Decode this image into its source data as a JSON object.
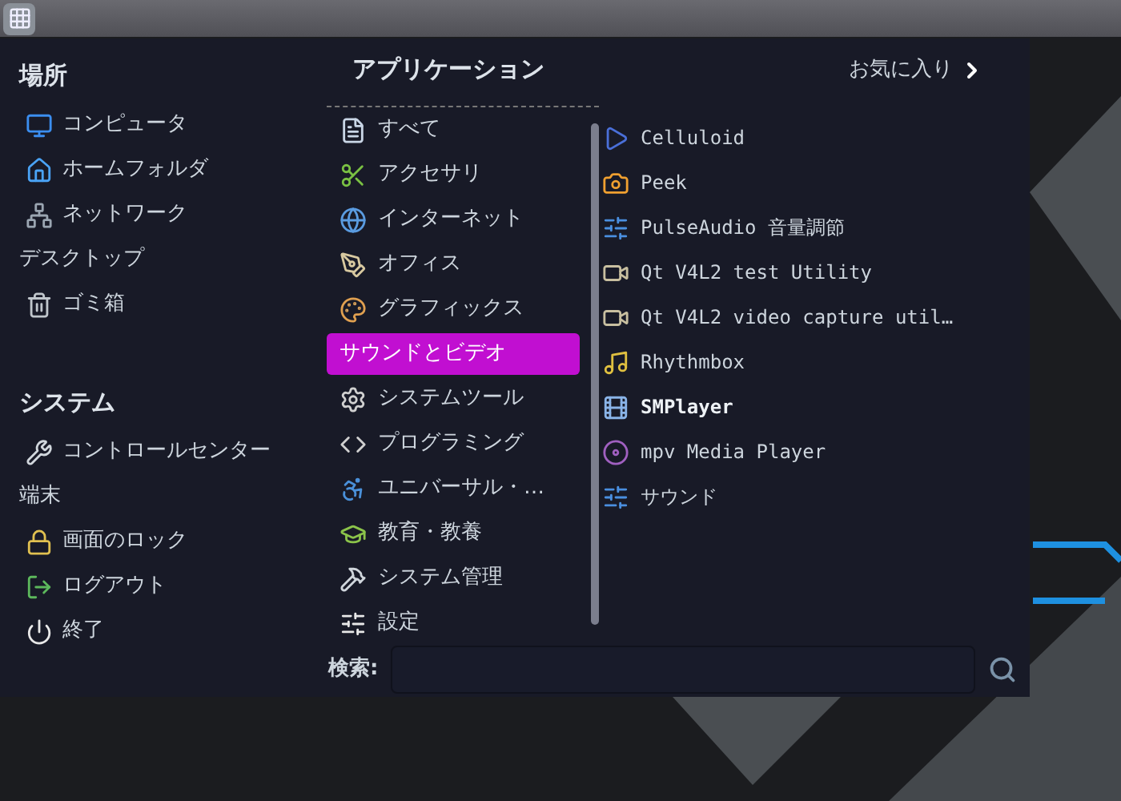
{
  "places": {
    "title": "場所",
    "items": [
      {
        "label": "コンピュータ",
        "kind": "with_icon"
      },
      {
        "label": "ホームフォルダ",
        "kind": "with_icon"
      },
      {
        "label": "ネットワーク",
        "kind": "with_icon"
      },
      {
        "label": "デスクトップ",
        "kind": "text_only"
      },
      {
        "label": "ゴミ箱",
        "kind": "with_icon"
      }
    ]
  },
  "system": {
    "title": "システム",
    "items": [
      {
        "label": "コントロールセンター",
        "kind": "with_icon"
      },
      {
        "label": "端末",
        "kind": "text_only"
      },
      {
        "label": "画面のロック",
        "kind": "with_icon"
      },
      {
        "label": "ログアウト",
        "kind": "with_icon"
      },
      {
        "label": "終了",
        "kind": "with_icon"
      }
    ]
  },
  "applications": {
    "title": "アプリケーション",
    "categories": [
      {
        "label": "すべて",
        "selected": false
      },
      {
        "label": "アクセサリ",
        "selected": false
      },
      {
        "label": "インターネット",
        "selected": false
      },
      {
        "label": "オフィス",
        "selected": false
      },
      {
        "label": "グラフィックス",
        "selected": false
      },
      {
        "label": "サウンドとビデオ",
        "selected": true
      },
      {
        "label": "システムツール",
        "selected": false
      },
      {
        "label": "プログラミング",
        "selected": false
      },
      {
        "label": "ユニバーサル・…",
        "selected": false
      },
      {
        "label": "教育・教養",
        "selected": false
      },
      {
        "label": "システム管理",
        "selected": false
      },
      {
        "label": "設定",
        "selected": false
      }
    ]
  },
  "favorites_link": "お気に入り",
  "apps": [
    {
      "label": "Celluloid",
      "highlighted": false
    },
    {
      "label": "Peek",
      "highlighted": false
    },
    {
      "label": "PulseAudio 音量調節",
      "highlighted": false
    },
    {
      "label": "Qt V4L2 test Utility",
      "highlighted": false
    },
    {
      "label": "Qt V4L2 video capture util…",
      "highlighted": false
    },
    {
      "label": "Rhythmbox",
      "highlighted": false
    },
    {
      "label": "SMPlayer",
      "highlighted": true
    },
    {
      "label": "mpv Media Player",
      "highlighted": false
    },
    {
      "label": "サウンド",
      "highlighted": false
    }
  ],
  "search": {
    "label": "検索:"
  }
}
